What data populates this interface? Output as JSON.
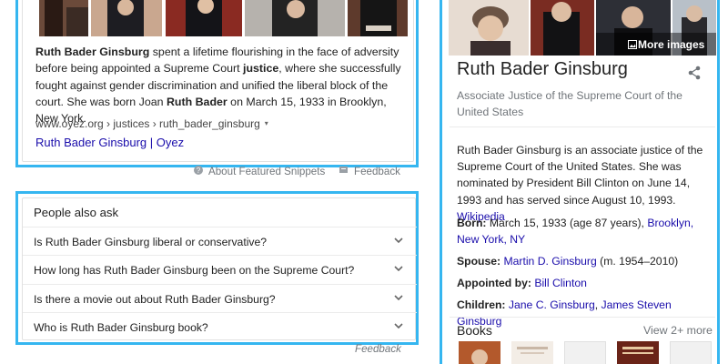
{
  "featured_snippet": {
    "paragraph": [
      {
        "t": "Ruth Bader Ginsburg",
        "b": true
      },
      {
        "t": " spent a lifetime flourishing in the face of adversity before being appointed a Supreme Court ",
        "b": false
      },
      {
        "t": "justice",
        "b": true
      },
      {
        "t": ", where she successfully fought against gender discrimination and unified the liberal block of the court. She was born Joan ",
        "b": false
      },
      {
        "t": "Ruth Bader",
        "b": true
      },
      {
        "t": " on March 15, 1933 in Brooklyn, New York.",
        "b": false
      }
    ],
    "breadcrumb": "www.oyez.org › justices › ruth_bader_ginsburg",
    "breadcrumb_caret": "▾",
    "link_text": "Ruth Bader Ginsburg | Oyez",
    "about_label": "About Featured Snippets",
    "feedback_label": "Feedback"
  },
  "people_also_ask": {
    "title": "People also ask",
    "questions": [
      "Is Ruth Bader Ginsburg liberal or conservative?",
      "How long has Ruth Bader Ginsburg been on the Supreme Court?",
      "Is there a movie out about Ruth Bader Ginsburg?",
      "Who is Ruth Bader Ginsburg book?"
    ],
    "feedback_label": "Feedback"
  },
  "knowledge_panel": {
    "more_images_label": "More images",
    "title": "Ruth Bader Ginsburg",
    "subtitle": "Associate Justice of the Supreme Court of the United States",
    "description": "Ruth Bader Ginsburg is an associate justice of the United States. She was nominated by President Bill Clinton on June 14, 1993 and has served since August 10, 1993.",
    "description_full": "Ruth Bader Ginsburg is an associate justice of the Supreme Court of the United States. She was nominated by President Bill Clinton on June 14, 1993 and has served since August 10, 1993.",
    "description_link": "Wikipedia",
    "facts": {
      "born_label": "Born:",
      "born_text": "March 15, 1933 (age 87 years),",
      "born_link": "Brooklyn, New York, NY",
      "spouse_label": "Spouse:",
      "spouse_link": "Martin D. Ginsburg",
      "spouse_text": "(m. 1954–2010)",
      "appointed_label": "Appointed by:",
      "appointed_link": "Bill Clinton",
      "children_label": "Children:",
      "children_link_1": "Jane C. Ginsburg",
      "children_sep": ",",
      "children_link_2": "James Steven Ginsburg"
    },
    "books_title": "Books",
    "books_more": "View 2+ more"
  },
  "colors": {
    "frame_blue": "#35b6f0",
    "link_blue": "#1a0dab",
    "muted_gray": "#70757a"
  }
}
